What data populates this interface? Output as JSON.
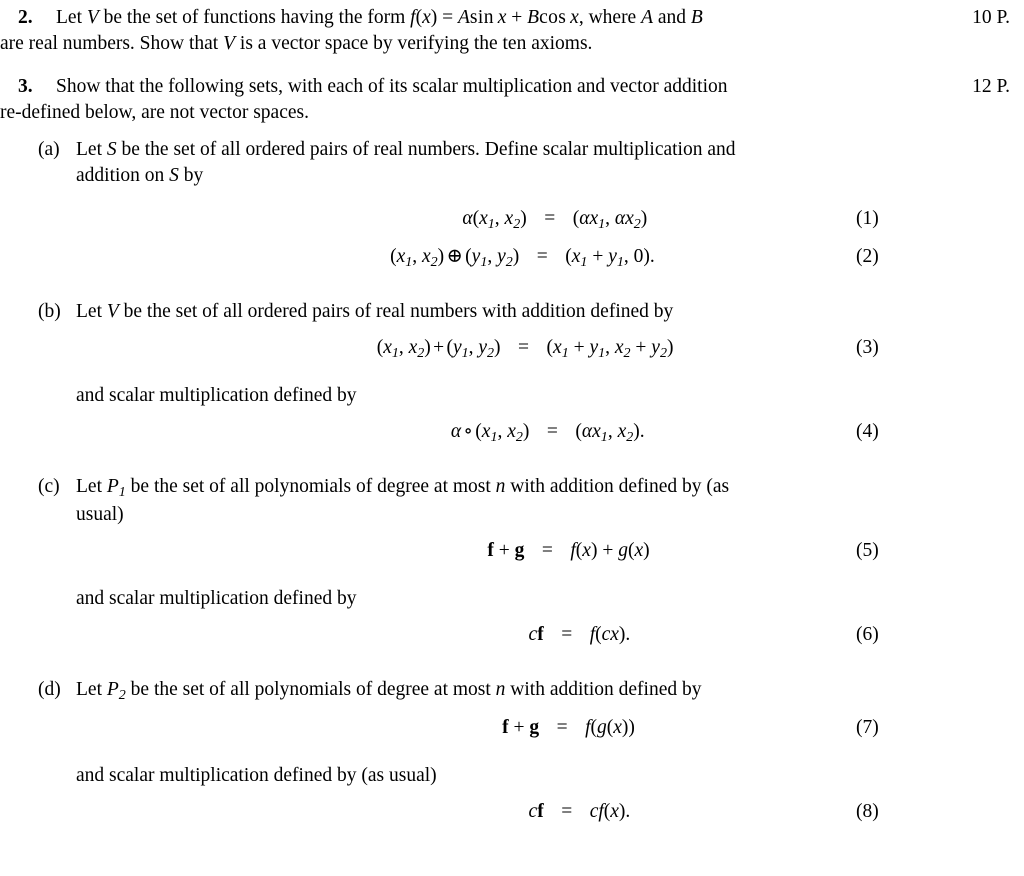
{
  "document": {
    "type": "math-exercise-sheet",
    "background_color": "#ffffff",
    "text_color": "#000000"
  },
  "problems": [
    {
      "number": "2.",
      "points": "10 P.",
      "line1_pre": "Let ",
      "line1_V": "V",
      "line1_mid": " be the set of functions having the form ",
      "formula_f": "f",
      "formula_paren_open": "(",
      "formula_x": "x",
      "formula_paren_close": ")",
      "formula_eq": " = ",
      "formula_A": "A",
      "formula_sin": "sin",
      "formula_x2": "x",
      "formula_plus": " + ",
      "formula_B": "B",
      "formula_cos": "cos",
      "formula_x3": "x",
      "line1_post": ", where ",
      "line1_A": "A",
      "line1_and": " and ",
      "line1_B": "B",
      "line2_pre": "are real numbers. Show that ",
      "line2_V": "V",
      "line2_post": " is a vector space by verifying the ten axioms."
    },
    {
      "number": "3.",
      "points": "12 P.",
      "line1": "Show that the following sets, with each of its scalar multiplication and vector addition",
      "line2": "re-defined below, are not vector spaces."
    }
  ],
  "subitems": [
    {
      "label": "(a)",
      "text_pre": "Let ",
      "sym1": "S",
      "text_mid": " be the set of all ordered pairs of real numbers. Define scalar multiplication and",
      "text_line2_pre": "addition on ",
      "sym2": "S",
      "text_line2_post": " by"
    },
    {
      "label": "(b)",
      "text_pre": "Let ",
      "sym1": "V",
      "text_mid": " be the set of all ordered pairs of real numbers with addition defined by",
      "tail": "and scalar multiplication defined by"
    },
    {
      "label": "(c)",
      "text_pre": "Let ",
      "sym1": "P",
      "sym1_sub": "1",
      "text_mid": " be the set of all polynomials of degree at most ",
      "sym_n": "n",
      "text_post": " with addition defined by (as",
      "text_line2": "usual)",
      "tail": "and scalar multiplication defined by"
    },
    {
      "label": "(d)",
      "text_pre": "Let ",
      "sym1": "P",
      "sym1_sub": "2",
      "text_mid": " be the set of all polynomials of degree at most ",
      "sym_n": "n",
      "text_post": " with addition defined by",
      "tail": "and scalar multiplication defined by (as usual)"
    }
  ],
  "equations": [
    {
      "id": "eq1",
      "number": "(1)",
      "lhs_parts": {
        "alpha": "α",
        "open": "(",
        "x": "x",
        "sub1": "1",
        "comma": ", ",
        "x2": "x",
        "sub2": "2",
        "close": ")"
      },
      "relation": "=",
      "rhs_parts": {
        "open": "(",
        "alpha1": "α",
        "x1": "x",
        "sub1": "1",
        "comma": ", ",
        "alpha2": "α",
        "x2": "x",
        "sub2": "2",
        "close": ")"
      }
    },
    {
      "id": "eq2",
      "number": "(2)",
      "lhs_parts": {
        "open": "(",
        "x": "x",
        "sub1": "1",
        "comma": ", ",
        "x2": "x",
        "sub2": "2",
        "close": ")",
        "op": "⊕",
        "open2": "(",
        "y": "y",
        "sub3": "1",
        "comma2": ", ",
        "y2": "y",
        "sub4": "2",
        "close2": ")"
      },
      "relation": "=",
      "rhs_parts": {
        "open": "(",
        "x": "x",
        "sub1": "1",
        "plus": " + ",
        "y": "y",
        "sub2": "1",
        "comma": ", ",
        "zero": "0",
        "close": ")."
      }
    },
    {
      "id": "eq3",
      "number": "(3)",
      "lhs_parts": {
        "open": "(",
        "x": "x",
        "sub1": "1",
        "comma": ", ",
        "x2": "x",
        "sub2": "2",
        "close": ")",
        "op": "+",
        "open2": "(",
        "y": "y",
        "sub3": "1",
        "comma2": ", ",
        "y2": "y",
        "sub4": "2",
        "close2": ")"
      },
      "relation": "=",
      "rhs_parts": {
        "open": "(",
        "x": "x",
        "sub1": "1",
        "plus": " + ",
        "y": "y",
        "sub2": "1",
        "comma": ", ",
        "x2": "x",
        "sub3": "2",
        "plus2": " + ",
        "y2": "y",
        "sub4": "2",
        "close": ")"
      }
    },
    {
      "id": "eq4",
      "number": "(4)",
      "lhs_parts": {
        "alpha": "α",
        "op": "∘",
        "open": "(",
        "x": "x",
        "sub1": "1",
        "comma": ", ",
        "x2": "x",
        "sub2": "2",
        "close": ")"
      },
      "relation": "=",
      "rhs_parts": {
        "open": "(",
        "alpha": "α",
        "x": "x",
        "sub1": "1",
        "comma": ", ",
        "x2": "x",
        "sub2": "2",
        "close": ")."
      }
    },
    {
      "id": "eq5",
      "number": "(5)",
      "lhs_parts": {
        "f": "f",
        "plus": " + ",
        "g": "g"
      },
      "relation": "=",
      "rhs_parts": {
        "f": "f",
        "open": "(",
        "x": "x",
        "close": ")",
        "plus": " + ",
        "g": "g",
        "open2": "(",
        "x2": "x",
        "close2": ")"
      }
    },
    {
      "id": "eq6",
      "number": "(6)",
      "lhs_parts": {
        "c": "c",
        "f": "f"
      },
      "relation": "=",
      "rhs_parts": {
        "f": "f",
        "open": "(",
        "c": "c",
        "x": "x",
        "close": ")."
      }
    },
    {
      "id": "eq7",
      "number": "(7)",
      "lhs_parts": {
        "f": "f",
        "plus": " + ",
        "g": "g"
      },
      "relation": "=",
      "rhs_parts": {
        "f": "f",
        "open": "(",
        "g": "g",
        "open2": "(",
        "x": "x",
        "close2": ")",
        "close": ")"
      }
    },
    {
      "id": "eq8",
      "number": "(8)",
      "lhs_parts": {
        "c": "c",
        "f": "f"
      },
      "relation": "=",
      "rhs_parts": {
        "c": "c",
        "f": "f",
        "open": "(",
        "x": "x",
        "close": ")."
      }
    }
  ]
}
